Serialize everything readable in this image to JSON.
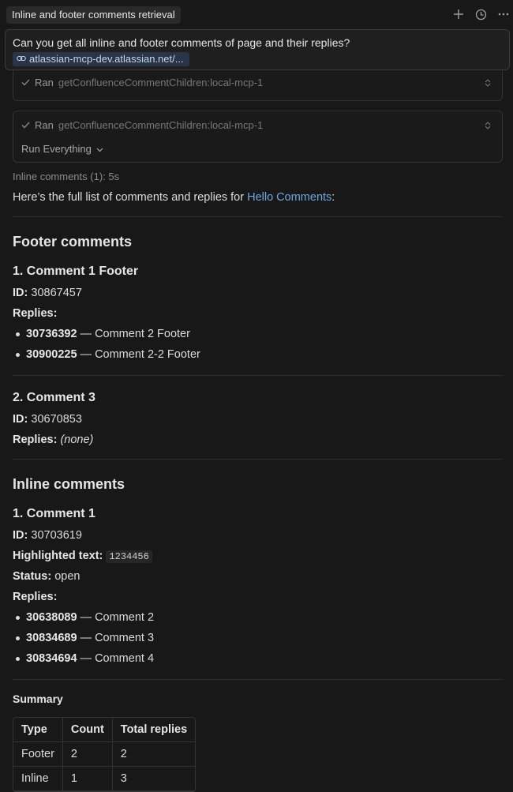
{
  "header": {
    "title": "Inline and footer comments retrieval",
    "icons": [
      "plus-icon",
      "history-icon",
      "more-icon"
    ]
  },
  "prompt": {
    "text": "Can you get all inline and footer comments of page and their replies?",
    "link_chip": "atlassian-mcp-dev.atlassian.net/..."
  },
  "tools": [
    {
      "status": "Ran",
      "name": "getConfluenceCommentChildren:local-mcp-1"
    },
    {
      "status": "Ran",
      "name": "getConfluenceCommentChildren:local-mcp-1",
      "run_label": "Run Everything"
    }
  ],
  "status_line": "Inline comments (1): 5s",
  "intro": {
    "prefix": "Here’s the full list of comments and replies for ",
    "link": "Hello Comments",
    "suffix": ":"
  },
  "footer_section": {
    "heading": "Footer comments",
    "comments": [
      {
        "title": "1. Comment 1 Footer",
        "id_label": "ID:",
        "id": "30867457",
        "replies_label": "Replies:",
        "replies": [
          {
            "id": "30736392",
            "text": " — Comment 2 Footer"
          },
          {
            "id": "30900225",
            "text": " — Comment 2-2 Footer"
          }
        ]
      },
      {
        "title": "2. Comment 3",
        "id_label": "ID:",
        "id": "30670853",
        "replies_label": "Replies:",
        "replies_none": "(none)"
      }
    ]
  },
  "inline_section": {
    "heading": "Inline comments",
    "comment": {
      "title": "1. Comment 1",
      "id_label": "ID:",
      "id": "30703619",
      "highlight_label": "Highlighted text:",
      "highlight": "1234456",
      "status_label": "Status:",
      "status": "open",
      "replies_label": "Replies:",
      "replies": [
        {
          "id": "30638089",
          "text": " — Comment 2"
        },
        {
          "id": "30834689",
          "text": " — Comment 3"
        },
        {
          "id": "30834694",
          "text": " — Comment 4"
        }
      ]
    }
  },
  "summary": {
    "heading": "Summary",
    "columns": [
      "Type",
      "Count",
      "Total replies"
    ],
    "rows": [
      [
        "Footer",
        "2",
        "2"
      ],
      [
        "Inline",
        "1",
        "3"
      ]
    ]
  }
}
